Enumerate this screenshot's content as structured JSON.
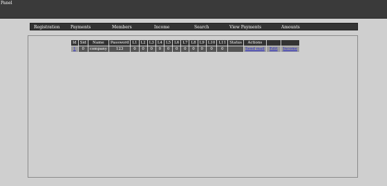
{
  "header": {
    "title": "Panel"
  },
  "nav": {
    "items": [
      {
        "label": "Registration"
      },
      {
        "label": "Payments"
      },
      {
        "label": "Members"
      },
      {
        "label": "Income"
      },
      {
        "label": "Search"
      },
      {
        "label": "View Payments"
      },
      {
        "label": "Amounts"
      }
    ]
  },
  "table": {
    "columns": [
      "Id",
      "Sid",
      "Name",
      "Password",
      "L1",
      "L2",
      "L3",
      "L4",
      "L5",
      "L6",
      "L7",
      "L8",
      "L9",
      "L10",
      "L11",
      "Status",
      "Actions",
      "",
      ""
    ],
    "rows": [
      {
        "id": "1",
        "sid": "0",
        "name": "company",
        "password": "123",
        "levels": [
          "0",
          "0",
          "0",
          "0",
          "0",
          "0",
          "0",
          "0",
          "0",
          "0",
          "0"
        ],
        "status": "",
        "actions": [
          "Send mail",
          "Edit",
          "Income"
        ]
      }
    ]
  }
}
